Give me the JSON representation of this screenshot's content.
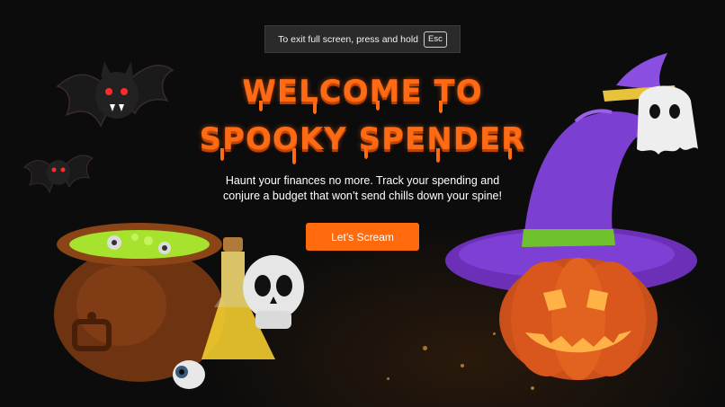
{
  "fullscreen_notice": {
    "text": "To exit full screen, press and hold",
    "key": "Esc"
  },
  "hero": {
    "title_line1": "WELCOME TO",
    "title_line2": "SPOOKY SPENDER",
    "subtitle": "Haunt your finances no more. Track your spending and conjure a budget that won’t send chills down your spine!",
    "cta_label": "Let’s Scream"
  },
  "colors": {
    "accent": "#ff6a13",
    "background": "#0c0c0c",
    "hat": "#7b3fd1",
    "pumpkin": "#d9561c",
    "cauldron": "#7a3a14",
    "potion": "#a6e22e"
  },
  "decorations": [
    "bat-icon",
    "bat-icon",
    "cauldron-icon",
    "skull-potion-icon",
    "eyeball-icon",
    "witch-hat-icon",
    "ghost-icon",
    "jack-o-lantern-icon"
  ]
}
